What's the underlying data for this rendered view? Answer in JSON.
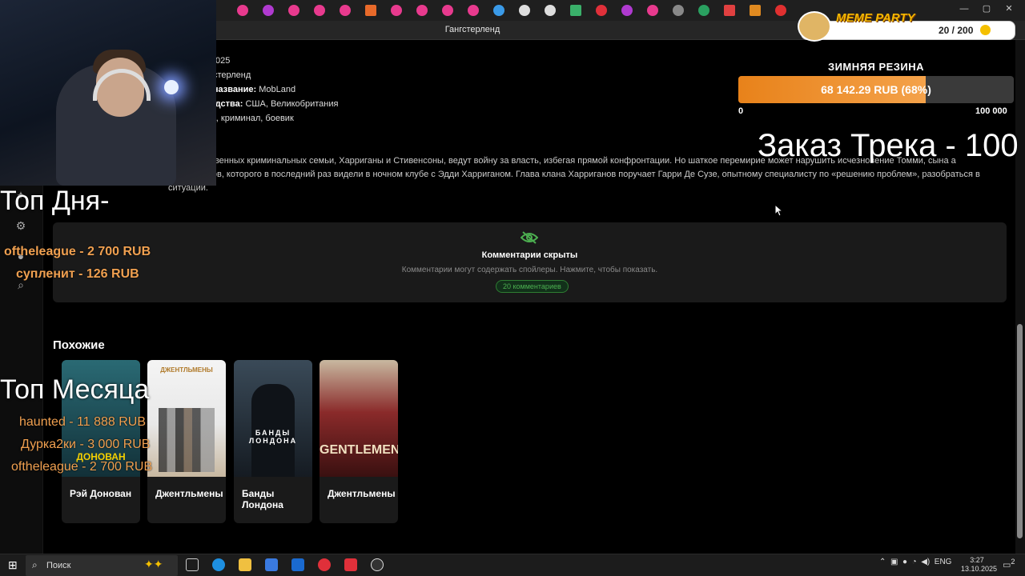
{
  "browser": {
    "page_title": "Гангстерленд",
    "window_controls": [
      "—",
      "▢",
      "✕"
    ]
  },
  "movie": {
    "meta": [
      {
        "key": "а:",
        "value": "2025"
      },
      {
        "key": "",
        "value": "ангстерленд"
      },
      {
        "key": "ое название:",
        "value": "MobLand"
      },
      {
        "key": "зводства:",
        "value": "США, Великобритания"
      },
      {
        "key": "",
        "value": "ама, криминал, боевик"
      }
    ],
    "description": "е могущественных криминальных семьи, Харриганы и Стивенсоны, ведут войну за власть, избегая прямой конфронтации. Но шаткое перемирие может нарушить исчезновение Томми, сына а Стивенсонов, которого в последний раз видели в ночном клубе с Эдди Харриганом. Глава клана Харриганов поручает Гарри Де Сузе, опытному специалисту по «решению проблем», разобраться в ситуации."
  },
  "comments": {
    "title": "Комментарии скрыты",
    "subtitle": "Комментарии могут содержать спойлеры. Нажмите, чтобы показать.",
    "badge": "20 комментариев"
  },
  "similar": {
    "title": "Похожие",
    "items": [
      {
        "name": "Рэй Донован",
        "poster_text": "ДОНОВАН",
        "poster_color": "#1f4f5c"
      },
      {
        "name": "Джентльмены",
        "poster_text": "ДЖЕНТЛЬМЕНЫ",
        "poster_color": "#f2f2f2"
      },
      {
        "name": "Банды Лондона",
        "poster_text": "БАНДЫ ЛОНДОНА",
        "poster_color": "#2a3440"
      },
      {
        "name": "Джентльмены",
        "poster_text": "GENTLEMEN",
        "poster_color": "#7a1e1e"
      }
    ]
  },
  "overlay": {
    "top_day_title": "Топ Дня-",
    "top_day": [
      "oftheleague - 2 700 RUB",
      "супленит - 126 RUB"
    ],
    "top_month_title": "Топ Месяца",
    "top_month": [
      "haunted - 11 888 RUB",
      "Дурка2ки - 3 000 RUB",
      "oftheleague - 2 700 RUB"
    ],
    "goal": {
      "title": "ЗИМНЯЯ РЕЗИНА",
      "text": "68 142.29 RUB (68%)",
      "progress": 0.68,
      "min": "0",
      "max": "100 000"
    },
    "track": "Заказ Трека - 100",
    "meme_party": {
      "label": "MEME PARTY",
      "count": "20 / 200"
    }
  },
  "taskbar": {
    "search_placeholder": "Поиск",
    "lang": "ENG",
    "time": "3:27",
    "date": "13.10.2025",
    "notifications": "2"
  }
}
